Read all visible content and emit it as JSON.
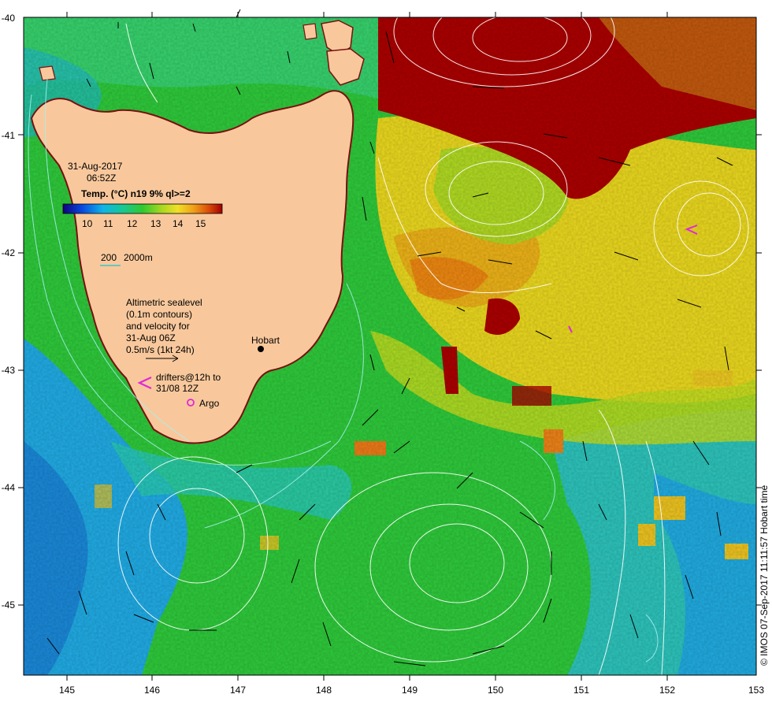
{
  "map": {
    "date": "31-Aug-2017",
    "time": "06:52Z",
    "colorbar_title": "Temp. (°C) n19 9% ql>=2",
    "colorbar_ticks": [
      "10",
      "11",
      "12",
      "13",
      "14",
      "15"
    ],
    "depth_label_200": "200",
    "depth_label_2000": "2000m",
    "altimetry_lines": [
      "Altimetric sealevel",
      "(0.1m contours)",
      "and velocity for",
      "31-Aug 06Z",
      "0.5m/s (1kt 24h)"
    ],
    "place_hobart": "Hobart",
    "drifters_lines": [
      "drifters@12h to",
      "31/08 12Z"
    ],
    "argo_label": "Argo",
    "credit": "© IMOS 07-Sep-2017 11:11:57 Hobart time",
    "lon_ticks": [
      "145",
      "146",
      "147",
      "148",
      "149",
      "150",
      "151",
      "152",
      "153"
    ],
    "lat_ticks": [
      "-40",
      "-41",
      "-42",
      "-43",
      "-44",
      "-45"
    ],
    "colors": {
      "land": "#f8c89c",
      "ssw_green": "#33c23a",
      "ssw_yellow": "#e8d21c",
      "ssw_red": "#a80000",
      "ssw_blue": "#1c8ed8",
      "contour": "#ffffff",
      "drifter": "#e028d8"
    }
  }
}
